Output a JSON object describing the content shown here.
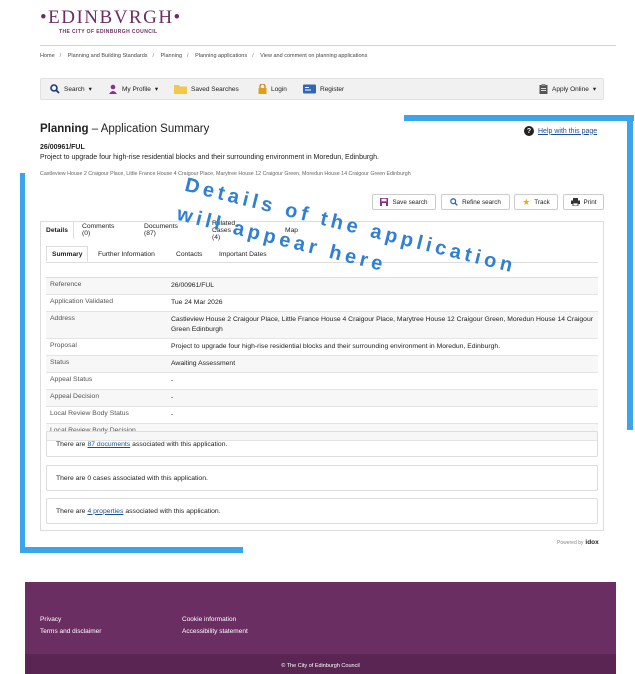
{
  "brand": {
    "name": "EDINBVRGH",
    "subtitle": "THE CITY OF EDINBURGH COUNCIL",
    "color": "#6c2f63"
  },
  "breadcrumb": [
    "Home",
    "Planning and Building Standards",
    "Planning",
    "Planning applications",
    "View and comment on planning applications"
  ],
  "menu": {
    "search": "Search",
    "profile": "My Profile",
    "saved": "Saved Searches",
    "login": "Login",
    "register": "Register",
    "apply": "Apply Online"
  },
  "page": {
    "title_bold": "Planning",
    "title_rest": "– Application Summary",
    "help": "Help with this page",
    "reference": "26/00961/FUL",
    "description": "Project to upgrade four high-rise residential blocks and their surrounding environment in Moredun, Edinburgh.",
    "address": "Castleview House 2 Craigour Place, Little France House 4 Craigour Place, Marytree House 12 Craigour Green, Moredun House 14 Craigour Green Edinburgh"
  },
  "actions": {
    "save": "Save search",
    "refine": "Refine search",
    "track": "Track",
    "print": "Print"
  },
  "overlay": {
    "line1": "Details of the application",
    "line2": "will appear here"
  },
  "tabs": [
    "Details",
    "Comments (0)",
    "Documents (87)",
    "Related Cases (4)",
    "Map"
  ],
  "subtabs": [
    "Summary",
    "Further Information",
    "Contacts",
    "Important Dates"
  ],
  "summary": [
    {
      "label": "Reference",
      "value": "26/00961/FUL"
    },
    {
      "label": "Application Validated",
      "value": "Tue 24 Mar 2026"
    },
    {
      "label": "Address",
      "value": "Castleview House 2 Craigour Place, Little France House 4 Craigour Place, Marytree House 12 Craigour Green, Moredun House 14 Craigour Green Edinburgh"
    },
    {
      "label": "Proposal",
      "value": "Project to upgrade four high-rise residential blocks and their surrounding environment in Moredun, Edinburgh."
    },
    {
      "label": "Status",
      "value": "Awaiting Assessment"
    },
    {
      "label": "Appeal Status",
      "value": "-"
    },
    {
      "label": "Appeal Decision",
      "value": "-"
    },
    {
      "label": "Local Review Body Status",
      "value": "-"
    },
    {
      "label": "Local Review Body Decision",
      "value": "-"
    }
  ],
  "associated": {
    "docs_pre": "There are",
    "docs_link": "87 documents",
    "docs_post": "associated with this application.",
    "cases_text": "There are 0 cases associated with this application.",
    "props_pre": "There are",
    "props_link": "4 properties",
    "props_post": "associated with this application."
  },
  "powered": {
    "label": "Powered by",
    "brand": "idox"
  },
  "footer": {
    "privacy": "Privacy",
    "terms": "Terms and disclaimer",
    "cookie": "Cookie information",
    "accessibility": "Accessibility statement",
    "copyright": "© The City of Edinburgh Council"
  },
  "colors": {
    "accent_blue": "#3ba4ea",
    "footer": "#6b2e63",
    "link": "#1a4e95"
  }
}
